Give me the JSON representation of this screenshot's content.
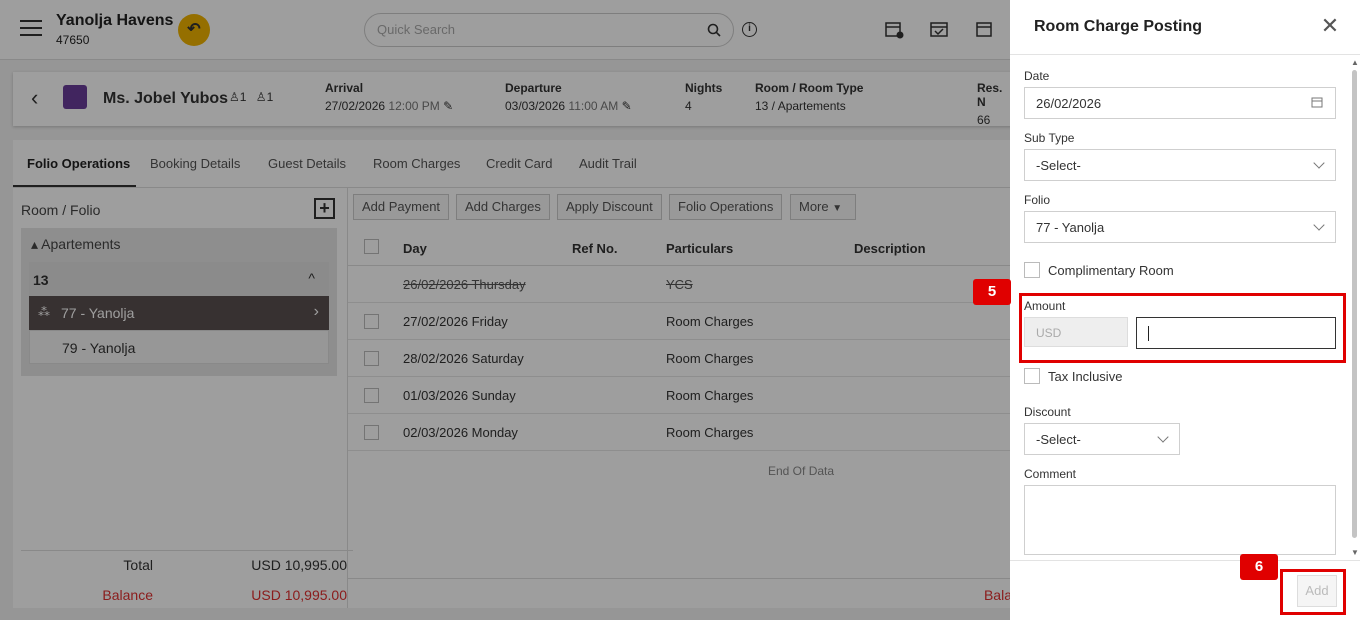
{
  "topbar": {
    "hotel_name": "Yanolja Havens",
    "hotel_code": "47650",
    "search_placeholder": "Quick Search"
  },
  "guest": {
    "name": "Ms. Jobel Yubos",
    "adults": "1",
    "children": "1",
    "arrival_label": "Arrival",
    "arrival_date": "27/02/2026",
    "arrival_time": "12:00 PM",
    "departure_label": "Departure",
    "departure_date": "03/03/2026",
    "departure_time": "11:00 AM",
    "nights_label": "Nights",
    "nights": "4",
    "room_label": "Room / Room Type",
    "room_value": "13 / Apartements",
    "res_label": "Res. N",
    "res_value": "66"
  },
  "tabs": [
    "Folio Operations",
    "Booking Details",
    "Guest Details",
    "Room Charges",
    "Credit Card",
    "Audit Trail"
  ],
  "room_folio": {
    "title": "Room / Folio",
    "group": "Apartements",
    "room": "13",
    "folios": [
      "77 - Yanolja",
      "79 - Yanolja"
    ]
  },
  "totals": {
    "total_label": "Total",
    "total_value": "USD 10,995.00",
    "balance_label": "Balance",
    "balance_value": "USD 10,995.00"
  },
  "actions": [
    "Add Payment",
    "Add Charges",
    "Apply Discount",
    "Folio Operations",
    "More"
  ],
  "grid": {
    "headers": [
      "Day",
      "Ref No.",
      "Particulars",
      "Description"
    ],
    "rows": [
      {
        "day": "26/02/2026 Thursday",
        "particulars": "YCS"
      },
      {
        "day": "27/02/2026 Friday",
        "particulars": "Room Charges"
      },
      {
        "day": "28/02/2026 Saturday",
        "particulars": "Room Charges"
      },
      {
        "day": "01/03/2026 Sunday",
        "particulars": "Room Charges"
      },
      {
        "day": "02/03/2026 Monday",
        "particulars": "Room Charges"
      }
    ],
    "end_text": "End Of Data",
    "footer_text": "Bala"
  },
  "panel": {
    "title": "Room Charge Posting",
    "date_label": "Date",
    "date_value": "26/02/2026",
    "subtype_label": "Sub Type",
    "subtype_value": "-Select-",
    "folio_label": "Folio",
    "folio_value": "77 - Yanolja",
    "complimentary_label": "Complimentary Room",
    "amount_label": "Amount",
    "currency": "USD",
    "amount_value": "",
    "tax_label": "Tax Inclusive",
    "discount_label": "Discount",
    "discount_value": "-Select-",
    "comment_label": "Comment",
    "add_label": "Add"
  },
  "annotations": {
    "step5": "5",
    "step6": "6",
    "color": "#e00000"
  }
}
